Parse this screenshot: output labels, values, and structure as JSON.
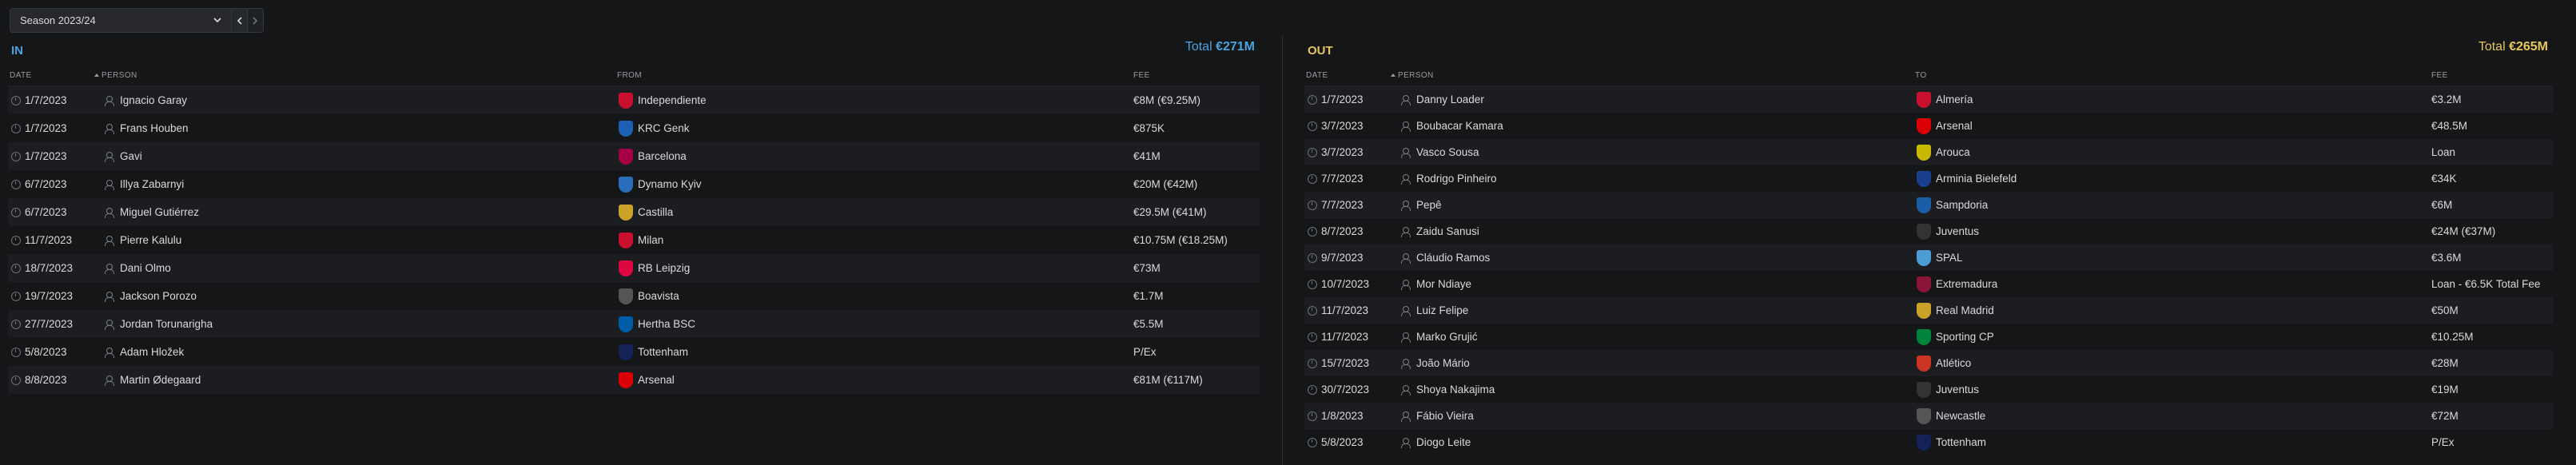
{
  "season": {
    "label": "Season 2023/24"
  },
  "colors": {
    "in_accent": "#4aa3df",
    "out_accent": "#e7c65c"
  },
  "in_panel": {
    "title": "IN",
    "total_prefix": "Total",
    "total_value": "€271M",
    "columns": {
      "date": "DATE",
      "person": "PERSON",
      "club": "FROM",
      "fee": "FEE"
    },
    "rows": [
      {
        "date": "1/7/2023",
        "person": "Ignacio Garay",
        "club": "Independiente",
        "fee": "€8M (€9.25M)",
        "badge_icon": "independiente-badge-icon",
        "badge_color": "#c8102e"
      },
      {
        "date": "1/7/2023",
        "person": "Frans Houben",
        "club": "KRC Genk",
        "fee": "€875K",
        "badge_icon": "krc-genk-badge-icon",
        "badge_color": "#1d5fb4"
      },
      {
        "date": "1/7/2023",
        "person": "Gavi",
        "club": "Barcelona",
        "fee": "€41M",
        "badge_icon": "barcelona-badge-icon",
        "badge_color": "#a50044"
      },
      {
        "date": "6/7/2023",
        "person": "Illya Zabarnyi",
        "club": "Dynamo Kyiv",
        "fee": "€20M (€42M)",
        "badge_icon": "dynamo-kyiv-badge-icon",
        "badge_color": "#2a6ebb"
      },
      {
        "date": "6/7/2023",
        "person": "Miguel Gutiérrez",
        "club": "Castilla",
        "fee": "€29.5M (€41M)",
        "badge_icon": "castilla-badge-icon",
        "badge_color": "#c9a227"
      },
      {
        "date": "11/7/2023",
        "person": "Pierre Kalulu",
        "club": "Milan",
        "fee": "€10.75M (€18.25M)",
        "badge_icon": "milan-badge-icon",
        "badge_color": "#c8102e"
      },
      {
        "date": "18/7/2023",
        "person": "Dani Olmo",
        "club": "RB Leipzig",
        "fee": "€73M",
        "badge_icon": "rb-leipzig-badge-icon",
        "badge_color": "#dd0741"
      },
      {
        "date": "19/7/2023",
        "person": "Jackson Porozo",
        "club": "Boavista",
        "fee": "€1.7M",
        "badge_icon": "boavista-badge-icon",
        "badge_color": "#555555"
      },
      {
        "date": "27/7/2023",
        "person": "Jordan Torunarigha",
        "club": "Hertha BSC",
        "fee": "€5.5M",
        "badge_icon": "hertha-bsc-badge-icon",
        "badge_color": "#005ca9"
      },
      {
        "date": "5/8/2023",
        "person": "Adam Hložek",
        "club": "Tottenham",
        "fee": "P/Ex",
        "badge_icon": "tottenham-badge-icon",
        "badge_color": "#132257"
      },
      {
        "date": "8/8/2023",
        "person": "Martin Ødegaard",
        "club": "Arsenal",
        "fee": "€81M (€117M)",
        "badge_icon": "arsenal-badge-icon",
        "badge_color": "#db0007"
      }
    ]
  },
  "out_panel": {
    "title": "OUT",
    "total_prefix": "Total",
    "total_value": "€265M",
    "columns": {
      "date": "DATE",
      "person": "PERSON",
      "club": "TO",
      "fee": "FEE"
    },
    "rows": [
      {
        "date": "1/7/2023",
        "person": "Danny Loader",
        "club": "Almería",
        "fee": "€3.2M",
        "badge_icon": "almeria-badge-icon",
        "badge_color": "#c8102e"
      },
      {
        "date": "3/7/2023",
        "person": "Boubacar Kamara",
        "club": "Arsenal",
        "fee": "€48.5M",
        "badge_icon": "arsenal-badge-icon",
        "badge_color": "#db0007"
      },
      {
        "date": "3/7/2023",
        "person": "Vasco Sousa",
        "club": "Arouca",
        "fee": "Loan",
        "badge_icon": "arouca-badge-icon",
        "badge_color": "#c9b800"
      },
      {
        "date": "7/7/2023",
        "person": "Rodrigo Pinheiro",
        "club": "Arminia Bielefeld",
        "fee": "€34K",
        "badge_icon": "arminia-bielefeld-badge-icon",
        "badge_color": "#1b3f8f"
      },
      {
        "date": "7/7/2023",
        "person": "Pepê",
        "club": "Sampdoria",
        "fee": "€6M",
        "badge_icon": "sampdoria-badge-icon",
        "badge_color": "#1b5ea8"
      },
      {
        "date": "8/7/2023",
        "person": "Zaidu Sanusi",
        "club": "Juventus",
        "fee": "€24M (€37M)",
        "badge_icon": "juventus-badge-icon",
        "badge_color": "#333333"
      },
      {
        "date": "9/7/2023",
        "person": "Cláudio Ramos",
        "club": "SPAL",
        "fee": "€3.6M",
        "badge_icon": "spal-badge-icon",
        "badge_color": "#4b9cd3"
      },
      {
        "date": "10/7/2023",
        "person": "Mor Ndiaye",
        "club": "Extremadura",
        "fee": "Loan - €6.5K Total Fee",
        "badge_icon": "extremadura-badge-icon",
        "badge_color": "#8a1538"
      },
      {
        "date": "11/7/2023",
        "person": "Luiz Felipe",
        "club": "Real Madrid",
        "fee": "€50M",
        "badge_icon": "real-madrid-badge-icon",
        "badge_color": "#c9a227"
      },
      {
        "date": "11/7/2023",
        "person": "Marko Grujić",
        "club": "Sporting CP",
        "fee": "€10.25M",
        "badge_icon": "sporting-cp-badge-icon",
        "badge_color": "#00843d"
      },
      {
        "date": "15/7/2023",
        "person": "João Mário",
        "club": "Atlético",
        "fee": "€28M",
        "badge_icon": "atletico-badge-icon",
        "badge_color": "#cb3524"
      },
      {
        "date": "30/7/2023",
        "person": "Shoya Nakajima",
        "club": "Juventus",
        "fee": "€19M",
        "badge_icon": "juventus-badge-icon",
        "badge_color": "#333333"
      },
      {
        "date": "1/8/2023",
        "person": "Fábio Vieira",
        "club": "Newcastle",
        "fee": "€72M",
        "badge_icon": "newcastle-badge-icon",
        "badge_color": "#555555"
      },
      {
        "date": "5/8/2023",
        "person": "Diogo Leite",
        "club": "Tottenham",
        "fee": "P/Ex",
        "badge_icon": "tottenham-badge-icon",
        "badge_color": "#132257"
      }
    ]
  }
}
